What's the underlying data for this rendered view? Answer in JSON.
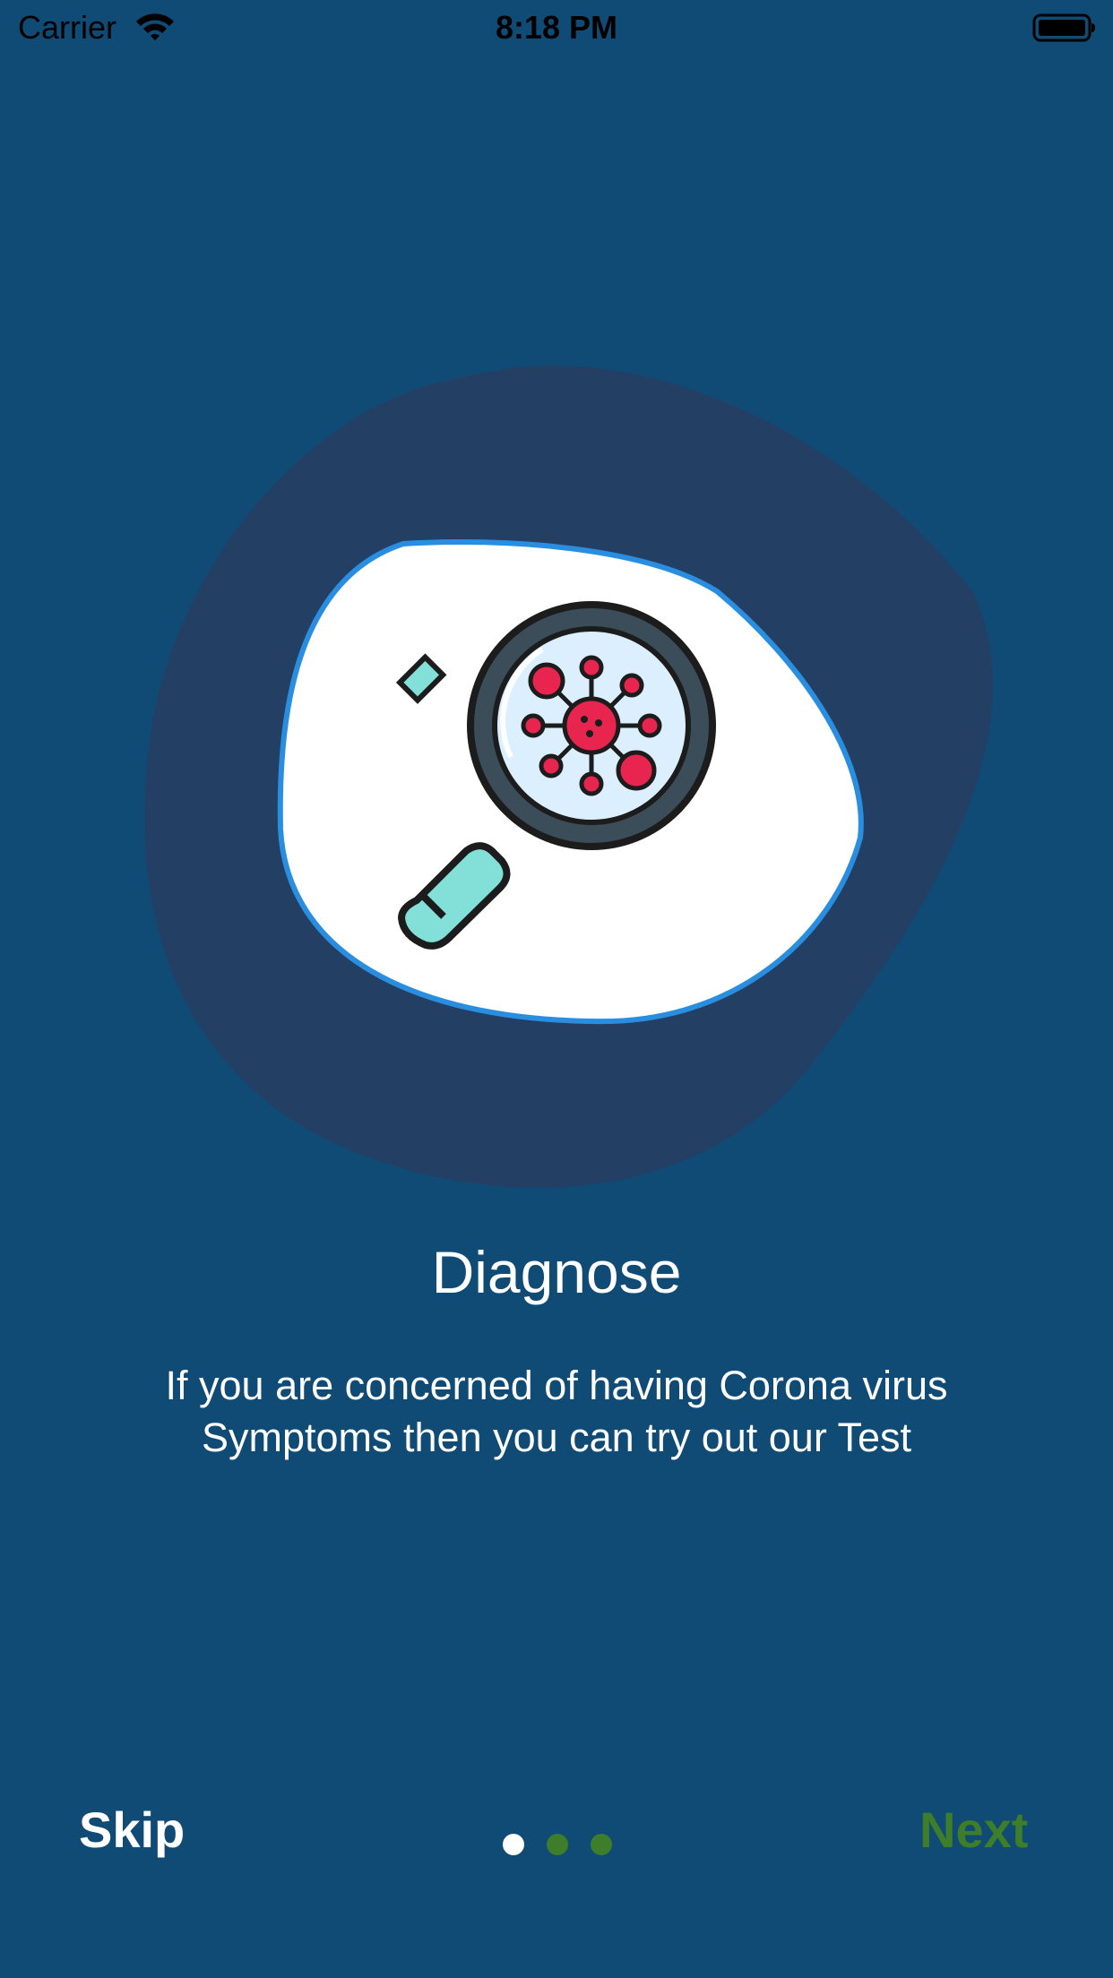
{
  "status_bar": {
    "carrier": "Carrier",
    "time": "8:18 PM",
    "icons": [
      "wifi-icon",
      "battery-icon"
    ]
  },
  "illustration": {
    "icon": "virus-magnifier-icon",
    "colors": {
      "blob_outer": "#233f63",
      "blob_inner": "#ffffff",
      "blob_border": "#2a8ee0",
      "lens": "#dcefff",
      "virus": "#e8254f",
      "handle": "#82e0d8"
    }
  },
  "onboarding": {
    "title": "Diagnose",
    "description_lines": [
      "If you are concerned of having Corona virus",
      "Symptoms then you can try out our Test"
    ]
  },
  "navigation": {
    "skip_label": "Skip",
    "next_label": "Next",
    "page_indicator": {
      "current": 1,
      "total": 3,
      "active_color": "#ffffff",
      "inactive_color": "#3e7d2a"
    }
  },
  "colors": {
    "background": "#104b75",
    "next_text": "#3e7d2a"
  }
}
